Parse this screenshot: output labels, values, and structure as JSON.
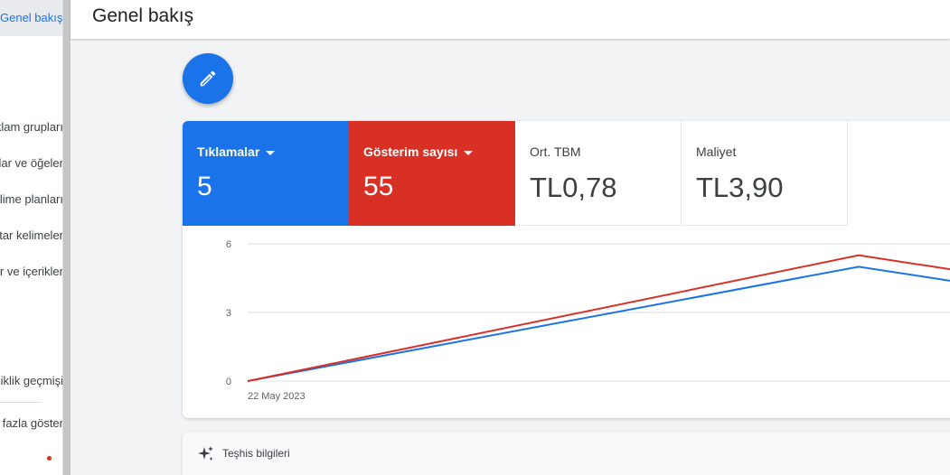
{
  "sidebar": {
    "items": [
      {
        "label": "Genel bakış",
        "active": true
      },
      {
        "label": "Reklam grupları"
      },
      {
        "label": "Reklamlar ve öğeler"
      },
      {
        "label": "Anahtar kelime planları"
      },
      {
        "label": "Anahtar kelimeler"
      },
      {
        "label": "Kitleler, anahtar kelimeler ve içerikler"
      },
      {
        "label": "Değişiklik geçmişi"
      },
      {
        "label": "Daha fazla göster"
      }
    ]
  },
  "header": {
    "title": "Genel bakış"
  },
  "fab": {
    "icon": "pencil-icon"
  },
  "metrics": {
    "clicks": {
      "label": "Tıklamalar",
      "value": "5",
      "color": "#1a73e8"
    },
    "impressions": {
      "label": "Gösterim sayısı",
      "value": "55",
      "color": "#d93025"
    },
    "avg_cpc": {
      "label": "Ort. TBM",
      "value": "TL0,78"
    },
    "cost": {
      "label": "Maliyet",
      "value": "TL3,90"
    }
  },
  "chart_data": {
    "type": "line",
    "x": [
      "22 May 2023",
      "",
      ""
    ],
    "x_tick_labels": [
      "22 May 2023"
    ],
    "y_ticks": [
      "6",
      "3",
      "0"
    ],
    "ylim": [
      0,
      6
    ],
    "grid": true,
    "series": [
      {
        "name": "Tıklamalar",
        "color": "#1a73e8",
        "values": [
          0,
          5,
          4.2
        ]
      },
      {
        "name": "Gösterim sayısı",
        "color": "#d93025",
        "values": [
          0,
          5.5,
          4.7
        ]
      }
    ]
  },
  "diagnostics": {
    "label": "Teşhis bilgileri",
    "icon": "sparkle-icon"
  }
}
